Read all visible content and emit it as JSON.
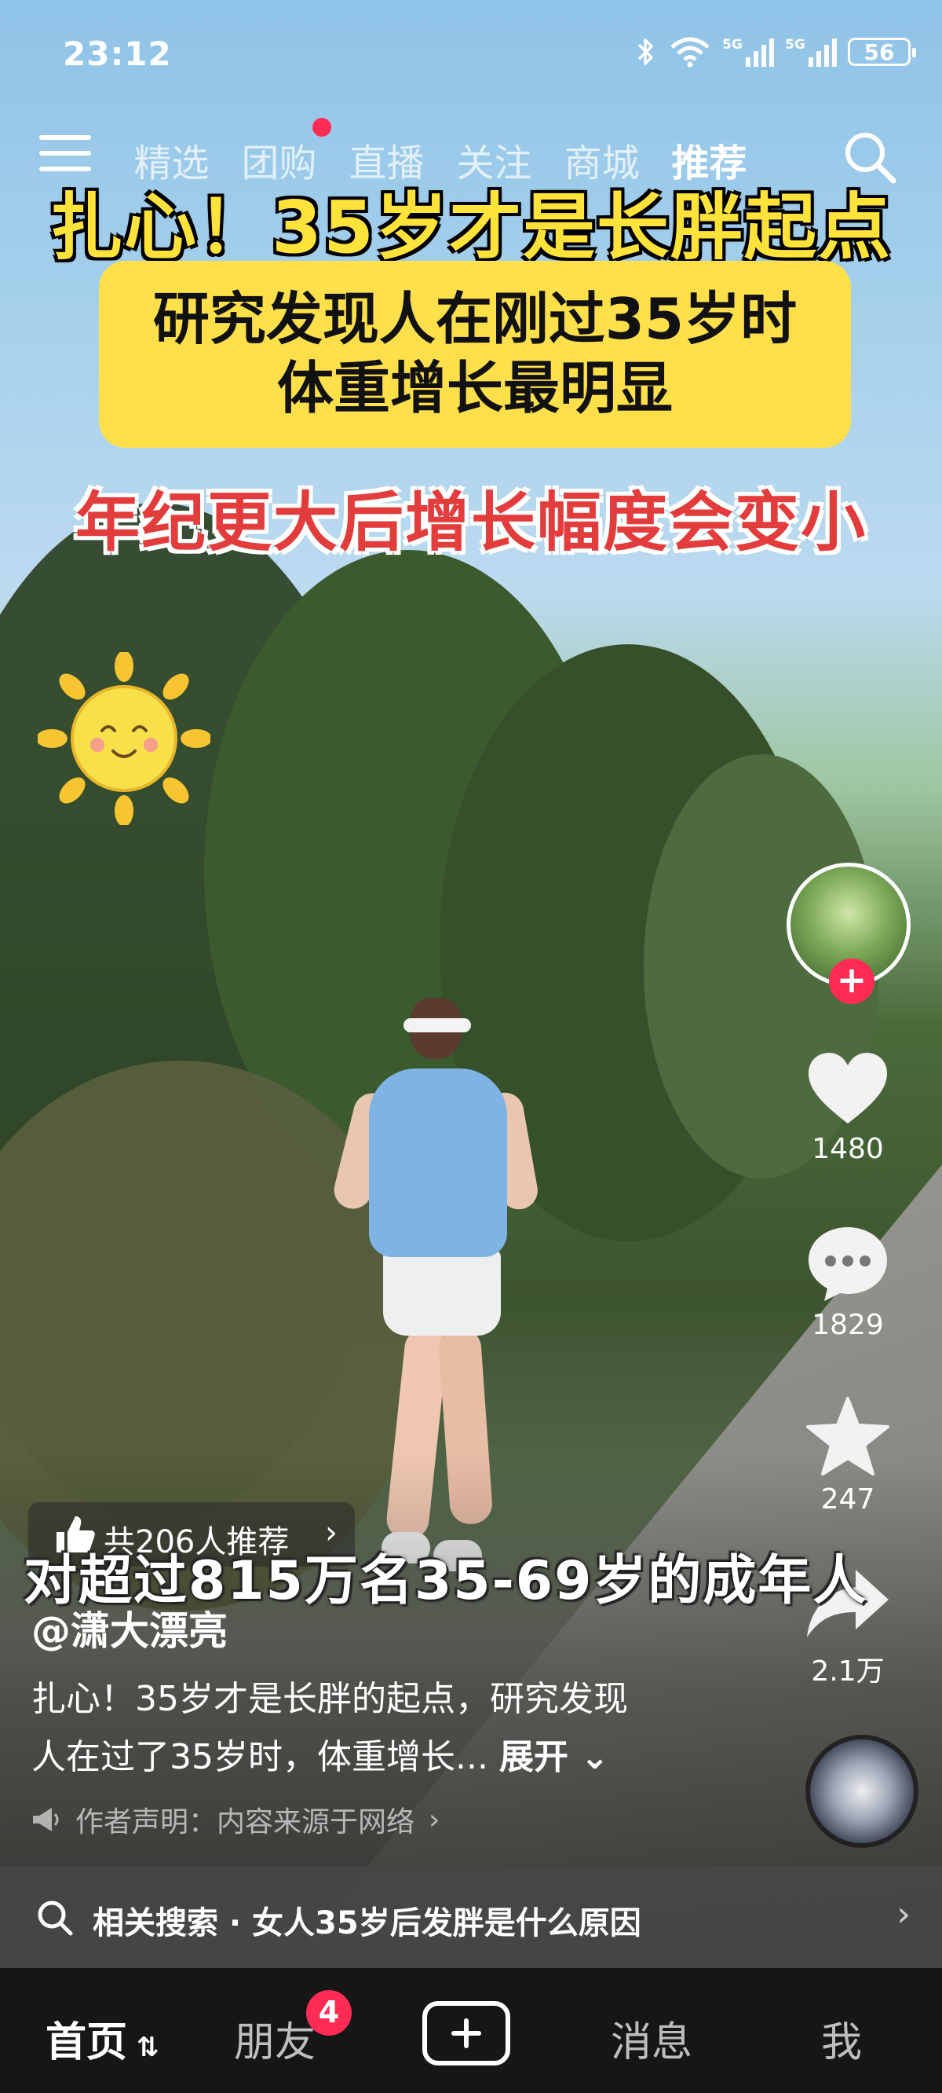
{
  "status_bar": {
    "time": "23:12",
    "battery": "56",
    "signal_label": "5G"
  },
  "top_nav": {
    "tabs": [
      "精选",
      "团购",
      "直播",
      "关注",
      "商城",
      "推荐"
    ]
  },
  "video": {
    "caption_title": "扎心！35岁才是长胖起点",
    "caption_box_line1": "研究发现人在刚过35岁时",
    "caption_box_line2": "体重增长最明显",
    "caption_red": "年纪更大后增长幅度会变小",
    "subtitle": "对超过815万名35-69岁的成年人"
  },
  "actions": {
    "likes": "1480",
    "comments": "1829",
    "favorites": "247",
    "shares": "2.1万"
  },
  "info": {
    "recommend": "共206人推荐",
    "author": "@潇大漂亮",
    "desc_line1": "扎心！35岁才是长胖的起点，研究发现",
    "desc_line2": "人在过了35岁时，体重增长...",
    "expand": "展开",
    "notice": "作者声明：内容来源于网络"
  },
  "related_search": {
    "text": "相关搜索 · 女人35岁后发胖是什么原因"
  },
  "tab_bar": {
    "home": "首页",
    "friends": "朋友",
    "friends_badge": "4",
    "messages": "消息",
    "me": "我"
  }
}
